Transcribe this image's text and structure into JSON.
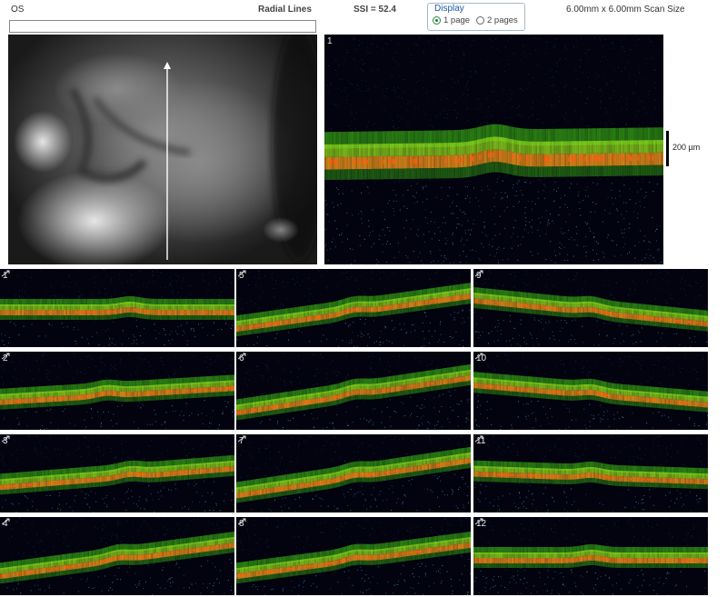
{
  "header": {
    "eye": "OS",
    "protocol": "Radial Lines",
    "ssi": "SSI = 52.4",
    "scan_size": "6.00mm x 6.00mm Scan Size"
  },
  "display": {
    "legend": "Display",
    "options": [
      "1 page",
      "2 pages"
    ],
    "selected": "1 page"
  },
  "main_scan": {
    "label": "1",
    "scale_label": "200 µm"
  },
  "thumbnails": [
    {
      "label": "1",
      "slope": 0.0,
      "dip": 0.55
    },
    {
      "label": "5",
      "slope": 0.42,
      "dip": 0.5
    },
    {
      "label": "9",
      "slope": -0.3,
      "dip": 0.5
    },
    {
      "label": "2",
      "slope": 0.18,
      "dip": 0.45
    },
    {
      "label": "6",
      "slope": 0.45,
      "dip": 0.5
    },
    {
      "label": "10",
      "slope": -0.25,
      "dip": 0.5
    },
    {
      "label": "3",
      "slope": 0.24,
      "dip": 0.55
    },
    {
      "label": "7",
      "slope": 0.45,
      "dip": 0.5
    },
    {
      "label": "11",
      "slope": -0.1,
      "dip": 0.5
    },
    {
      "label": "4",
      "slope": 0.4,
      "dip": 0.5
    },
    {
      "label": "8",
      "slope": 0.4,
      "dip": 0.5
    },
    {
      "label": "12",
      "slope": 0.0,
      "dip": 0.5
    }
  ],
  "colors": {
    "background": "#02030f",
    "retina_outer": "#2f8f14",
    "retina_mid": "#8fd81c",
    "rpe": "#e08b1a",
    "rpe_hot": "#ff5a10",
    "choroid": "#4a7fb0"
  }
}
